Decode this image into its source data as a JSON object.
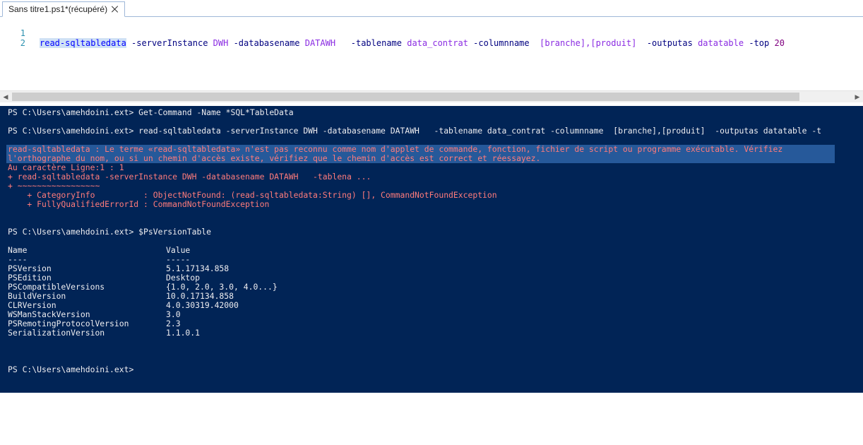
{
  "tab": {
    "title": "Sans titre1.ps1*(récupéré)"
  },
  "editor": {
    "line_numbers": [
      "1",
      "2"
    ],
    "line1": {
      "cmd": "read-sqltabledata",
      "seg1": " -serverInstance ",
      "arg1": "DWH",
      "seg2": " -databasename ",
      "arg2": "DATAWH",
      "seg3": "   -tablename ",
      "arg3": "data_contrat",
      "seg4": " -columnname  ",
      "arg4": "[branche],[produit]",
      "seg5": "  -outputas ",
      "arg5": "datatable",
      "seg6": " -top ",
      "arg6": "20"
    }
  },
  "console": {
    "line_get_command": "PS C:\\Users\\amehdoini.ext> Get-Command -Name *SQL*TableData",
    "line_read_cmd": "PS C:\\Users\\amehdoini.ext> read-sqltabledata -serverInstance DWH -databasename DATAWH   -tablename data_contrat -columnname  [branche],[produit]  -outputas datatable -t",
    "error_lines": [
      "read-sqltabledata : Le terme «read-sqltabledata» n'est pas reconnu comme nom d'applet de commande, fonction, fichier de script ou programme exécutable. Vérifiez",
      "l'orthographe du nom, ou si un chemin d'accès existe, vérifiez que le chemin d'accès est correct et réessayez.",
      "Au caractère Ligne:1 : 1",
      "+ read-sqltabledata -serverInstance DWH -databasename DATAWH   -tablena ...",
      "+ ~~~~~~~~~~~~~~~~~",
      "    + CategoryInfo          : ObjectNotFound: (read-sqltabledata:String) [], CommandNotFoundException",
      "    + FullyQualifiedErrorId : CommandNotFoundException"
    ],
    "line_psversion": "PS C:\\Users\\amehdoini.ext> $PsVersionTable",
    "table": {
      "header_name": "Name",
      "header_value": "Value",
      "sep_name": "----",
      "sep_value": "-----",
      "rows": [
        {
          "name": "PSVersion",
          "value": "5.1.17134.858"
        },
        {
          "name": "PSEdition",
          "value": "Desktop"
        },
        {
          "name": "PSCompatibleVersions",
          "value": "{1.0, 2.0, 3.0, 4.0...}"
        },
        {
          "name": "BuildVersion",
          "value": "10.0.17134.858"
        },
        {
          "name": "CLRVersion",
          "value": "4.0.30319.42000"
        },
        {
          "name": "WSManStackVersion",
          "value": "3.0"
        },
        {
          "name": "PSRemotingProtocolVersion",
          "value": "2.3"
        },
        {
          "name": "SerializationVersion",
          "value": "1.1.0.1"
        }
      ]
    },
    "prompt_final": "PS C:\\Users\\amehdoini.ext>"
  },
  "colors": {
    "console_bg": "#012456",
    "console_fg": "#eeedf0",
    "error_fg": "#ff7b7b",
    "selection": "#26599a"
  }
}
